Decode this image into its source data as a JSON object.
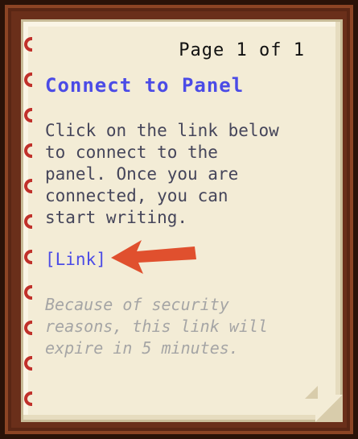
{
  "book": {
    "page_indicator": "Page 1 of 1",
    "title": "Connect to Panel",
    "body_text": "Click on the link below\nto connect to the\npanel. Once you are\nconnected, you can\nstart writing.",
    "link_text": "[Link]",
    "note_text": "Because of security\nreasons, this link will\nexpire in 5 minutes."
  },
  "colors": {
    "title": "#4b4be6",
    "link": "#4b4be6",
    "body": "#45455a",
    "note": "#a5a5a5",
    "paper": "#f3ecd6",
    "cover": "#6a2f1a",
    "binding_rings": "#c0302a",
    "arrow": "#e0502e"
  },
  "icons": {
    "binding": "ring-binding-icon",
    "pointer": "arrow-left-icon",
    "page_curl": "page-curl-icon"
  }
}
